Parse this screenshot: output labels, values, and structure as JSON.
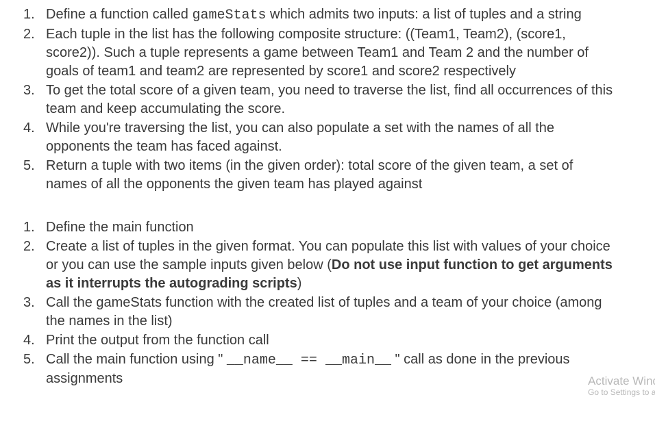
{
  "section1": {
    "items": [
      {
        "num": "1.",
        "before": "Define a function called ",
        "code": "gameStats",
        "after": " which admits two inputs: a list of tuples and a string"
      },
      {
        "num": "2.",
        "text": "Each tuple in the list has the following composite structure: ((Team1, Team2), (score1, score2)). Such a tuple represents a game between Team1 and Team 2 and the number of goals of team1 and team2 are represented by score1 and score2 respectively"
      },
      {
        "num": "3.",
        "text": "To get the total score of a given team, you need to traverse the list, find all occurrences of this team and keep accumulating the score."
      },
      {
        "num": "4.",
        "text": "While you're traversing the list, you can also populate a set with the names of all the opponents the team has faced against."
      },
      {
        "num": "5.",
        "text": "Return a tuple with two items (in the given order): total score of the given team, a set of names of all the opponents the given team has played against"
      }
    ]
  },
  "section2": {
    "items": [
      {
        "num": "1.",
        "text": "Define the main function"
      },
      {
        "num": "2.",
        "before": "Create a list of tuples in the given format. You can populate this list with values of your choice or you can use the sample inputs given below (",
        "bold": "Do not use input function to get arguments as it interrupts the autograding scripts",
        "after": ")"
      },
      {
        "num": "3.",
        "text": "Call the gameStats function with the created list of tuples and a team of your choice (among the names in the list)"
      },
      {
        "num": "4.",
        "text": "Print the output from the function call"
      },
      {
        "num": "5.",
        "before": "Call the main function using \" ",
        "code1": "__name__",
        "mid": "   ==   ",
        "code2": "__main__",
        "after": " \" call as done in the previous assignments"
      }
    ]
  },
  "watermark": {
    "line1": "Activate Wind",
    "line2": "Go to Settings to a"
  }
}
